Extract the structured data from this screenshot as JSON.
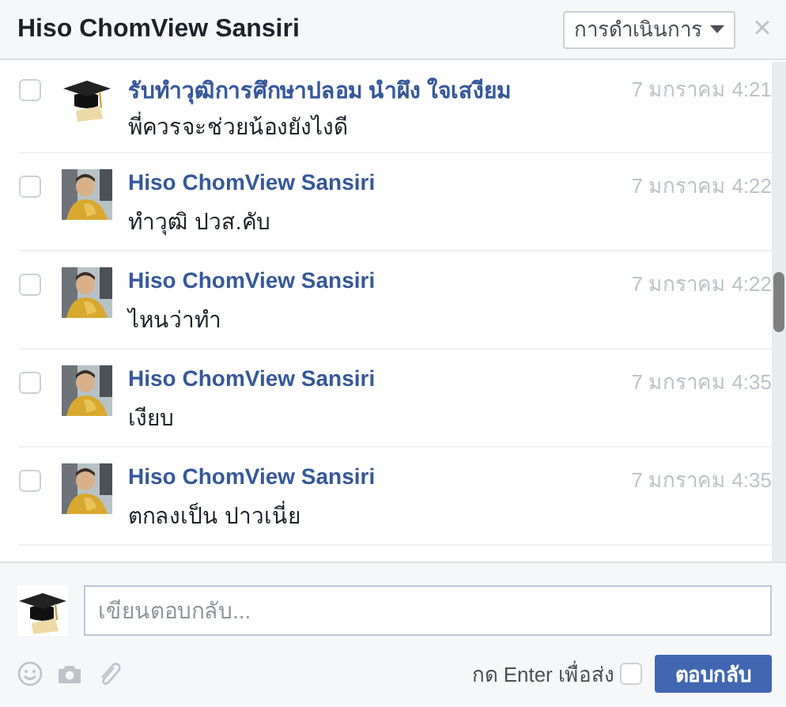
{
  "header": {
    "title": "Hiso ChomView Sansiri",
    "actions_button": "การดำเนินการ",
    "close": "×"
  },
  "messages": [
    {
      "avatar": {
        "kind": "cap"
      },
      "sender": "รับทำวุฒิการศึกษาปลอม นำผึง ใจเสงียม",
      "time": "7 มกราคม 4:21",
      "text": "พี่ควรจะช่วยน้องยังไงดี",
      "checked": false
    },
    {
      "sender": "Hiso ChomView Sansiri",
      "time": "7 มกราคม 4:22",
      "text": "ทำวุฒิ ปวส.คับ",
      "checked": false
    },
    {
      "sender": "Hiso ChomView Sansiri",
      "time": "7 มกราคม 4:22",
      "text": "ไหนว่าทำ",
      "checked": false
    },
    {
      "sender": "Hiso ChomView Sansiri",
      "time": "7 มกราคม 4:35",
      "text": "เงียบ",
      "checked": false
    },
    {
      "sender": "Hiso ChomView Sansiri",
      "time": "7 มกราคม 4:35",
      "text": "ตกลงเป็น ปาวเนี่ย",
      "checked": false
    }
  ],
  "composer": {
    "avatar": {
      "kind": "cap"
    },
    "placeholder": "เขียนตอบกลับ...",
    "enter_label": "กด Enter เพื่อส่ง",
    "enter_to_send": false,
    "reply_button": "ตอบกลับ"
  }
}
